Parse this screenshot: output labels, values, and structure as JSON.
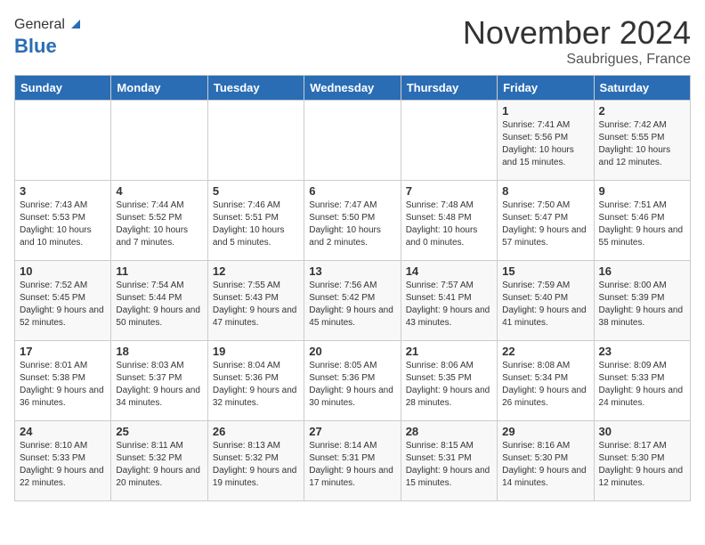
{
  "header": {
    "logo_general": "General",
    "logo_blue": "Blue",
    "month_title": "November 2024",
    "location": "Saubrigues, France"
  },
  "days_of_week": [
    "Sunday",
    "Monday",
    "Tuesday",
    "Wednesday",
    "Thursday",
    "Friday",
    "Saturday"
  ],
  "weeks": [
    [
      {
        "day": "",
        "info": ""
      },
      {
        "day": "",
        "info": ""
      },
      {
        "day": "",
        "info": ""
      },
      {
        "day": "",
        "info": ""
      },
      {
        "day": "",
        "info": ""
      },
      {
        "day": "1",
        "info": "Sunrise: 7:41 AM\nSunset: 5:56 PM\nDaylight: 10 hours and 15 minutes."
      },
      {
        "day": "2",
        "info": "Sunrise: 7:42 AM\nSunset: 5:55 PM\nDaylight: 10 hours and 12 minutes."
      }
    ],
    [
      {
        "day": "3",
        "info": "Sunrise: 7:43 AM\nSunset: 5:53 PM\nDaylight: 10 hours and 10 minutes."
      },
      {
        "day": "4",
        "info": "Sunrise: 7:44 AM\nSunset: 5:52 PM\nDaylight: 10 hours and 7 minutes."
      },
      {
        "day": "5",
        "info": "Sunrise: 7:46 AM\nSunset: 5:51 PM\nDaylight: 10 hours and 5 minutes."
      },
      {
        "day": "6",
        "info": "Sunrise: 7:47 AM\nSunset: 5:50 PM\nDaylight: 10 hours and 2 minutes."
      },
      {
        "day": "7",
        "info": "Sunrise: 7:48 AM\nSunset: 5:48 PM\nDaylight: 10 hours and 0 minutes."
      },
      {
        "day": "8",
        "info": "Sunrise: 7:50 AM\nSunset: 5:47 PM\nDaylight: 9 hours and 57 minutes."
      },
      {
        "day": "9",
        "info": "Sunrise: 7:51 AM\nSunset: 5:46 PM\nDaylight: 9 hours and 55 minutes."
      }
    ],
    [
      {
        "day": "10",
        "info": "Sunrise: 7:52 AM\nSunset: 5:45 PM\nDaylight: 9 hours and 52 minutes."
      },
      {
        "day": "11",
        "info": "Sunrise: 7:54 AM\nSunset: 5:44 PM\nDaylight: 9 hours and 50 minutes."
      },
      {
        "day": "12",
        "info": "Sunrise: 7:55 AM\nSunset: 5:43 PM\nDaylight: 9 hours and 47 minutes."
      },
      {
        "day": "13",
        "info": "Sunrise: 7:56 AM\nSunset: 5:42 PM\nDaylight: 9 hours and 45 minutes."
      },
      {
        "day": "14",
        "info": "Sunrise: 7:57 AM\nSunset: 5:41 PM\nDaylight: 9 hours and 43 minutes."
      },
      {
        "day": "15",
        "info": "Sunrise: 7:59 AM\nSunset: 5:40 PM\nDaylight: 9 hours and 41 minutes."
      },
      {
        "day": "16",
        "info": "Sunrise: 8:00 AM\nSunset: 5:39 PM\nDaylight: 9 hours and 38 minutes."
      }
    ],
    [
      {
        "day": "17",
        "info": "Sunrise: 8:01 AM\nSunset: 5:38 PM\nDaylight: 9 hours and 36 minutes."
      },
      {
        "day": "18",
        "info": "Sunrise: 8:03 AM\nSunset: 5:37 PM\nDaylight: 9 hours and 34 minutes."
      },
      {
        "day": "19",
        "info": "Sunrise: 8:04 AM\nSunset: 5:36 PM\nDaylight: 9 hours and 32 minutes."
      },
      {
        "day": "20",
        "info": "Sunrise: 8:05 AM\nSunset: 5:36 PM\nDaylight: 9 hours and 30 minutes."
      },
      {
        "day": "21",
        "info": "Sunrise: 8:06 AM\nSunset: 5:35 PM\nDaylight: 9 hours and 28 minutes."
      },
      {
        "day": "22",
        "info": "Sunrise: 8:08 AM\nSunset: 5:34 PM\nDaylight: 9 hours and 26 minutes."
      },
      {
        "day": "23",
        "info": "Sunrise: 8:09 AM\nSunset: 5:33 PM\nDaylight: 9 hours and 24 minutes."
      }
    ],
    [
      {
        "day": "24",
        "info": "Sunrise: 8:10 AM\nSunset: 5:33 PM\nDaylight: 9 hours and 22 minutes."
      },
      {
        "day": "25",
        "info": "Sunrise: 8:11 AM\nSunset: 5:32 PM\nDaylight: 9 hours and 20 minutes."
      },
      {
        "day": "26",
        "info": "Sunrise: 8:13 AM\nSunset: 5:32 PM\nDaylight: 9 hours and 19 minutes."
      },
      {
        "day": "27",
        "info": "Sunrise: 8:14 AM\nSunset: 5:31 PM\nDaylight: 9 hours and 17 minutes."
      },
      {
        "day": "28",
        "info": "Sunrise: 8:15 AM\nSunset: 5:31 PM\nDaylight: 9 hours and 15 minutes."
      },
      {
        "day": "29",
        "info": "Sunrise: 8:16 AM\nSunset: 5:30 PM\nDaylight: 9 hours and 14 minutes."
      },
      {
        "day": "30",
        "info": "Sunrise: 8:17 AM\nSunset: 5:30 PM\nDaylight: 9 hours and 12 minutes."
      }
    ]
  ]
}
